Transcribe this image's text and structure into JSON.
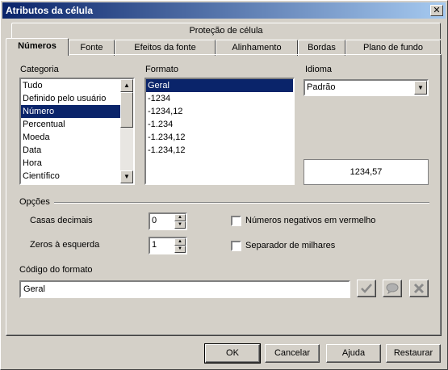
{
  "window": {
    "title": "Atributos da célula",
    "close_glyph": "✕"
  },
  "tabs": {
    "top_row": [
      "Proteção de célula"
    ],
    "bottom_row": [
      "Números",
      "Fonte",
      "Efeitos da fonte",
      "Alinhamento",
      "Bordas",
      "Plano de fundo"
    ],
    "active": "Números"
  },
  "category": {
    "label": "Categoria",
    "items": [
      "Tudo",
      "Definido pelo usuário",
      "Número",
      "Percentual",
      "Moeda",
      "Data",
      "Hora",
      "Científico"
    ],
    "selected": "Número"
  },
  "format": {
    "label": "Formato",
    "items": [
      "Geral",
      "-1234",
      "-1234,12",
      "-1.234",
      "-1.234,12",
      "-1.234,12"
    ],
    "selected": "Geral"
  },
  "language": {
    "label": "Idioma",
    "value": "Padrão"
  },
  "preview": {
    "value": "1234,57"
  },
  "options": {
    "label": "Opções",
    "decimal_places_label": "Casas decimais",
    "decimal_places_value": "0",
    "leading_zeros_label": "Zeros à esquerda",
    "leading_zeros_value": "1",
    "negative_red_label": "Números negativos em vermelho",
    "negative_red_checked": false,
    "thousands_sep_label": "Separador de milhares",
    "thousands_sep_checked": false
  },
  "format_code": {
    "label": "Código do formato",
    "value": "Geral"
  },
  "buttons": {
    "ok": "OK",
    "cancel": "Cancelar",
    "help": "Ajuda",
    "reset": "Restaurar"
  },
  "icons": {
    "accept": "check-icon",
    "comment": "comment-icon",
    "delete": "delete-icon"
  },
  "colors": {
    "title_start": "#0a246a",
    "title_end": "#a6caf0",
    "selection": "#0a246a",
    "face": "#d4d0c8"
  }
}
